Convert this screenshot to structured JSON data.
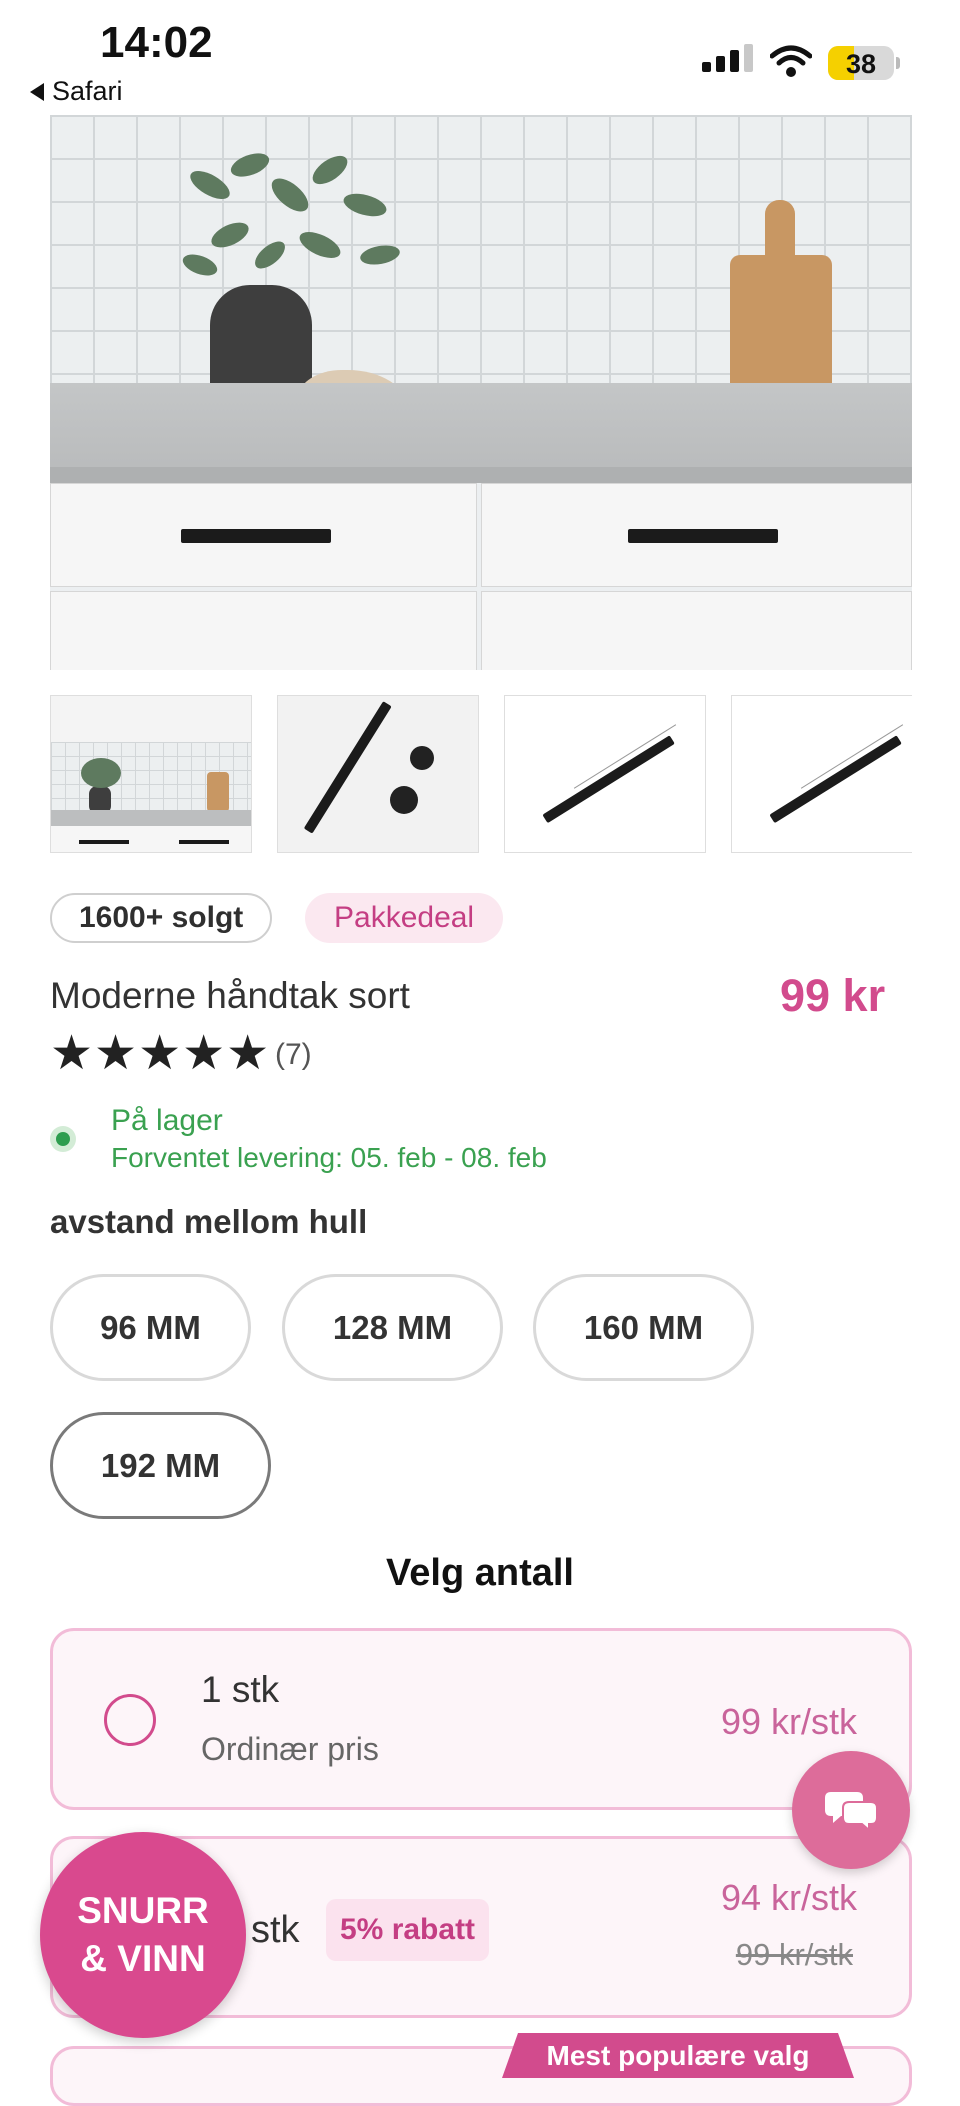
{
  "status_bar": {
    "time": "14:02",
    "back_label": "Safari",
    "battery_level": "38"
  },
  "gallery": {
    "main_image": "kitchen-drawers-black-handles",
    "thumbnails": [
      "kitchen-photo",
      "handle-and-knob",
      "handle-dimensions",
      "handle-dimensions-2"
    ]
  },
  "badges": {
    "sold": "1600+ solgt",
    "deal": "Pakkedeal"
  },
  "product": {
    "title": "Moderne håndtak sort",
    "price": "99 kr",
    "stars": "★★★★★",
    "rating": 5,
    "reviews": "(7)"
  },
  "stock": {
    "status": "På lager",
    "delivery": "Forventet levering: 05. feb - 08. feb"
  },
  "variant": {
    "label": "avstand mellom hull",
    "options": [
      "96 MM",
      "128 MM",
      "160 MM",
      "192 MM"
    ],
    "selected": "192 MM"
  },
  "quantity": {
    "heading": "Velg antall",
    "options": [
      {
        "qty": "1 stk",
        "subtitle": "Ordinær pris",
        "price": "99 kr/stk"
      },
      {
        "qty": "stk",
        "discount": "5% rabatt",
        "price": "94 kr/stk",
        "old_price": "99 kr/stk"
      }
    ],
    "popular_label": "Mest populære valg"
  },
  "promo": {
    "line1": "SNURR",
    "line2": "& VINN"
  },
  "colors": {
    "accent": "#d24b8d",
    "success": "#3aa150",
    "option_border": "#f2bcd8"
  }
}
